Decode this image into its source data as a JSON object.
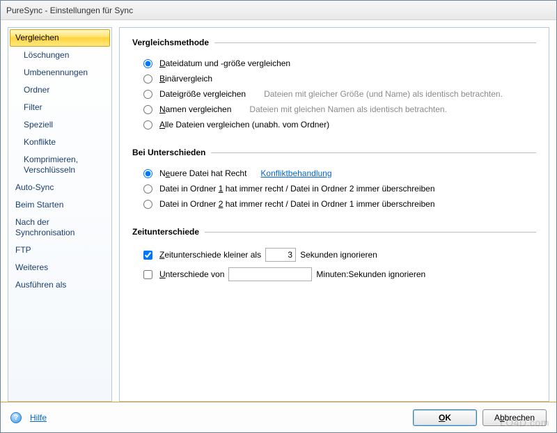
{
  "window": {
    "title": "PureSync - Einstellungen für Sync"
  },
  "sidebar": {
    "items": [
      {
        "label": "Vergleichen",
        "child": false,
        "selected": true
      },
      {
        "label": "Löschungen",
        "child": true,
        "selected": false
      },
      {
        "label": "Umbenennungen",
        "child": true,
        "selected": false
      },
      {
        "label": "Ordner",
        "child": true,
        "selected": false
      },
      {
        "label": "Filter",
        "child": true,
        "selected": false
      },
      {
        "label": "Speziell",
        "child": true,
        "selected": false
      },
      {
        "label": "Konflikte",
        "child": true,
        "selected": false
      },
      {
        "label": "Komprimieren, Verschlüsseln",
        "child": true,
        "selected": false
      },
      {
        "label": "Auto-Sync",
        "child": false,
        "selected": false
      },
      {
        "label": "Beim Starten",
        "child": false,
        "selected": false
      },
      {
        "label": "Nach der Synchronisation",
        "child": false,
        "selected": false
      },
      {
        "label": "FTP",
        "child": false,
        "selected": false
      },
      {
        "label": "Weiteres",
        "child": false,
        "selected": false
      },
      {
        "label": "Ausführen als",
        "child": false,
        "selected": false
      }
    ]
  },
  "groups": {
    "method": {
      "title": "Vergleichsmethode",
      "options": [
        {
          "pre": "",
          "u": "D",
          "post": "ateidatum und -größe vergleichen",
          "desc": "",
          "checked": true
        },
        {
          "pre": "",
          "u": "B",
          "post": "inärvergleich",
          "desc": "",
          "checked": false
        },
        {
          "pre": "Datei",
          "u": "g",
          "post": "röße vergleichen",
          "desc": "Dateien mit gleicher Größe (und Name) als identisch betrachten.",
          "checked": false
        },
        {
          "pre": "",
          "u": "N",
          "post": "amen vergleichen",
          "desc": "Dateien mit gleichen Namen als identisch betrachten.",
          "checked": false
        },
        {
          "pre": "",
          "u": "A",
          "post": "lle Dateien vergleichen (unabh. vom Ordner)",
          "desc": "",
          "checked": false
        }
      ]
    },
    "diff": {
      "title": "Bei Unterschieden",
      "link": "Konfliktbehandlung",
      "options": [
        {
          "pre": "N",
          "u": "e",
          "post": "uere Datei hat Recht",
          "checked": true
        },
        {
          "pre": "Datei in Ordner ",
          "u": "1",
          "post": " hat immer recht / Datei in Ordner 2 immer überschreiben",
          "checked": false
        },
        {
          "pre": "Datei in Ordner ",
          "u": "2",
          "post": " hat immer recht / Datei in Ordner 1 immer überschreiben",
          "checked": false
        }
      ]
    },
    "time": {
      "title": "Zeitunterschiede",
      "row1": {
        "pre": "",
        "u": "Z",
        "post": "eitunterschiede kleiner als",
        "value": "3",
        "suffix": "Sekunden ignorieren",
        "checked": true
      },
      "row2": {
        "pre": "",
        "u": "U",
        "post": "nterschiede von",
        "value": "",
        "suffix": "Minuten:Sekunden ignorieren",
        "checked": false
      }
    }
  },
  "footer": {
    "help": "Hilfe",
    "ok": "OK",
    "cancel": "Abbrechen"
  },
  "watermark": "LO4D.com"
}
